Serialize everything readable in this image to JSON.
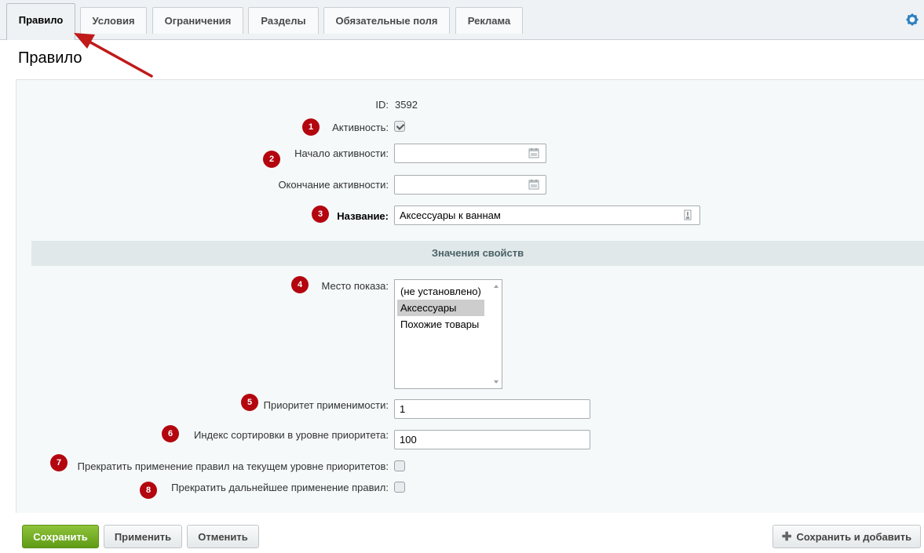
{
  "tabs": [
    {
      "label": "Правило"
    },
    {
      "label": "Условия"
    },
    {
      "label": "Ограничения"
    },
    {
      "label": "Разделы"
    },
    {
      "label": "Обязательные поля"
    },
    {
      "label": "Реклама"
    }
  ],
  "page": {
    "title": "Правило"
  },
  "form": {
    "id_label": "ID:",
    "id_value": "3592",
    "active_label": "Активность:",
    "active_checked": true,
    "start_label": "Начало активности:",
    "end_label": "Окончание активности:",
    "name_label": "Название:",
    "name_value": "Аксессуары к ваннам",
    "section_title": "Значения свойств",
    "place_label": "Место показа:",
    "place_options": [
      "(не установлено)",
      "Аксессуары",
      "Похожие товары"
    ],
    "place_selected": "Аксессуары",
    "priority_label": "Приоритет применимости:",
    "priority_value": "1",
    "sort_label": "Индекс сортировки в уровне приоритета:",
    "sort_value": "100",
    "stop_level_label": "Прекратить применение правил на текущем уровне приоритетов:",
    "stop_level_checked": false,
    "stop_all_label": "Прекратить дальнейшее применение правил:",
    "stop_all_checked": false
  },
  "badges": [
    "1",
    "2",
    "3",
    "4",
    "5",
    "6",
    "7",
    "8"
  ],
  "buttons": {
    "save": "Сохранить",
    "apply": "Применить",
    "cancel": "Отменить",
    "save_add": "Сохранить и добавить"
  },
  "icons": {
    "settings": "gear-icon",
    "calendar": "calendar-icon",
    "name_hint": "hint-icon",
    "add": "plus-icon"
  },
  "colors": {
    "badge": "#b3060f",
    "save_button": "#6aa51f",
    "arrow": "#c01a1a"
  }
}
